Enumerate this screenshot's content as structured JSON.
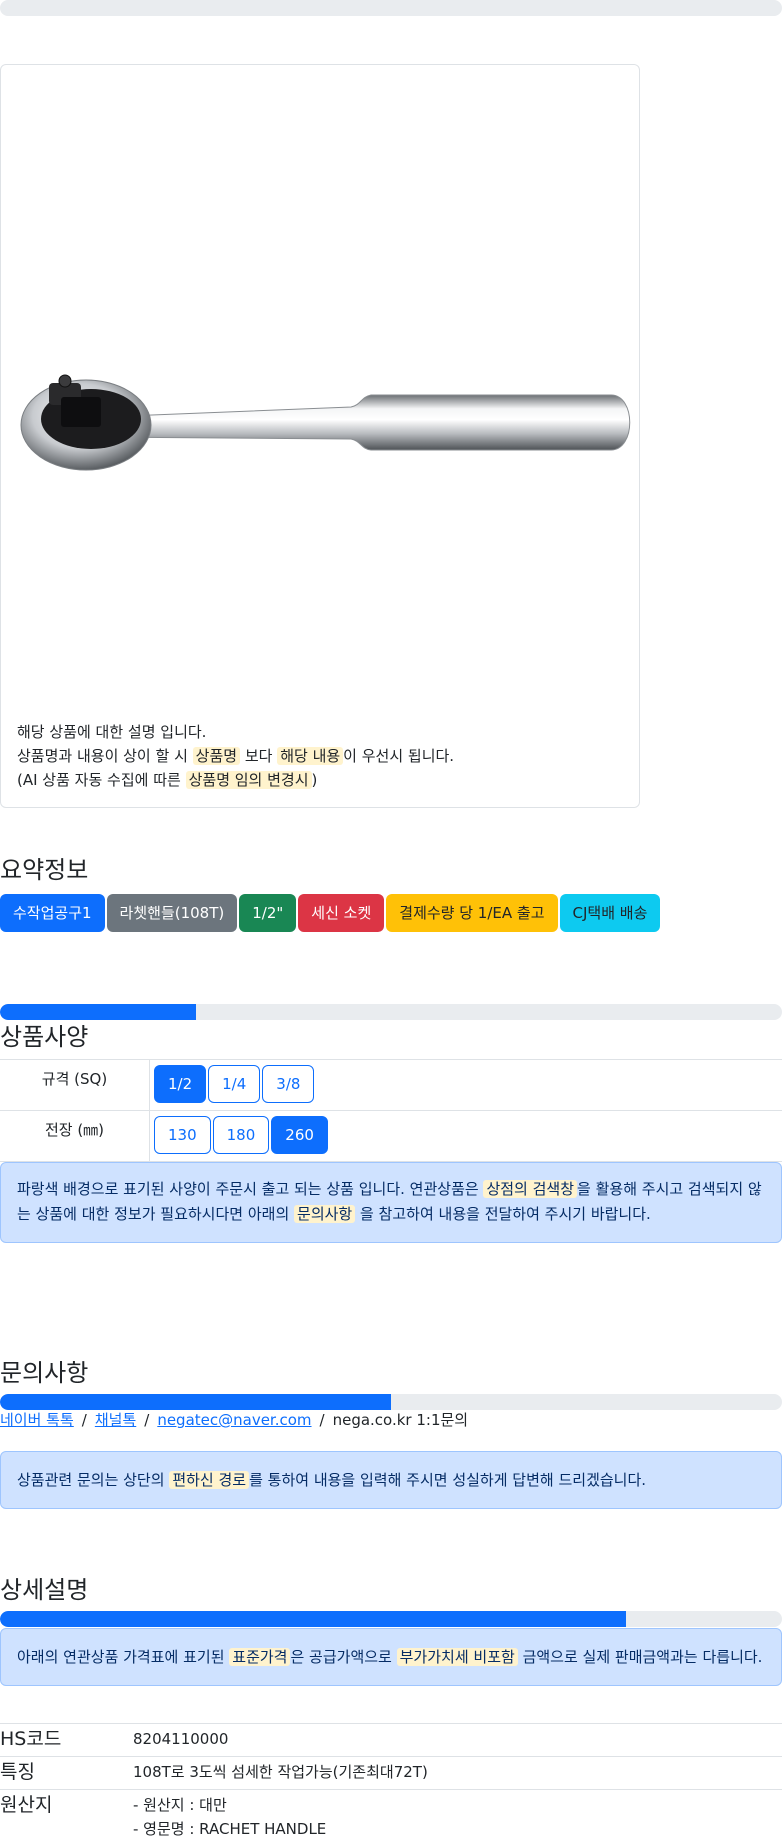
{
  "colors": {
    "primary": "#0d6efd",
    "secondary": "#6c757d",
    "success": "#198754",
    "danger": "#dc3545",
    "warning": "#ffc107",
    "info": "#0dcaf0",
    "alert_bg": "#cfe2ff",
    "highlight_bg": "#fff3cd"
  },
  "product": {
    "image_alt": "ratchet-handle",
    "desc_line1": "해당 상품에 대한 설명 입니다.",
    "desc_line2_pre": "상품명과 내용이 상이 할 시 ",
    "desc_line2_hl1": "상품명",
    "desc_line2_mid": " 보다 ",
    "desc_line2_hl2": "해당 내용",
    "desc_line2_post": "이 우선시 됩니다.",
    "desc_line3_pre": "(AI 상품 자동 수집에 따른 ",
    "desc_line3_hl": "상품명 임의 변경시",
    "desc_line3_post": ")"
  },
  "summary": {
    "title": "요약정보",
    "badges": [
      "수작업공구1",
      "라쳇핸들(108T)",
      "1/2\"",
      "세신 소켓",
      "결제수량 당 1/EA 출고",
      "CJ택배 배송"
    ]
  },
  "specs": {
    "title": "상품사양",
    "progress": 0.25,
    "rows": [
      {
        "label": "규격 (SQ)",
        "options": [
          "1/2",
          "1/4",
          "3/8"
        ],
        "selected": "1/2"
      },
      {
        "label": "전장 (㎜)",
        "options": [
          "130",
          "180",
          "260"
        ],
        "selected": "260"
      }
    ],
    "notice_pre": "파랑색 배경으로 표기된 사양이 주문시 출고 되는 상품 입니다. 연관상품은 ",
    "notice_hl1": "상점의 검색창",
    "notice_mid": "을 활용해 주시고 검색되지 않는 상품에 대한 정보가 필요하시다면 아래의 ",
    "notice_hl2": "문의사항",
    "notice_post": " 을 참고하여 내용을 전달하여 주시기 바랍니다."
  },
  "inquiry": {
    "title": "문의사항",
    "progress": 0.5,
    "links": [
      "네이버 톡톡",
      "채널톡",
      "negatec@naver.com"
    ],
    "separator": "/",
    "last_text": "nega.co.kr 1:1문의",
    "notice_pre": "상품관련 문의는 상단의 ",
    "notice_hl": "편하신 경로",
    "notice_post": "를 통하여 내용을 입력해 주시면 성실하게 답변해 드리겠습니다."
  },
  "detail": {
    "title": "상세설명",
    "progress": 0.8,
    "notice_pre": "아래의 연관상품 가격표에 표기된 ",
    "notice_hl1": "표준가격",
    "notice_mid": "은 공급가액으로 ",
    "notice_hl2": "부가가치세 비포함",
    "notice_post": " 금액으로 실제 판매금액과는 다릅니다.",
    "rows": [
      {
        "key": "HS코드",
        "value": "8204110000"
      },
      {
        "key": "특징",
        "value": "108T로 3도씩 섬세한 작업가능(기존최대72T)"
      },
      {
        "key": "원산지",
        "value1": "- 원산지 : 대만",
        "value2": "- 영문명 : RACHET HANDLE"
      }
    ]
  }
}
